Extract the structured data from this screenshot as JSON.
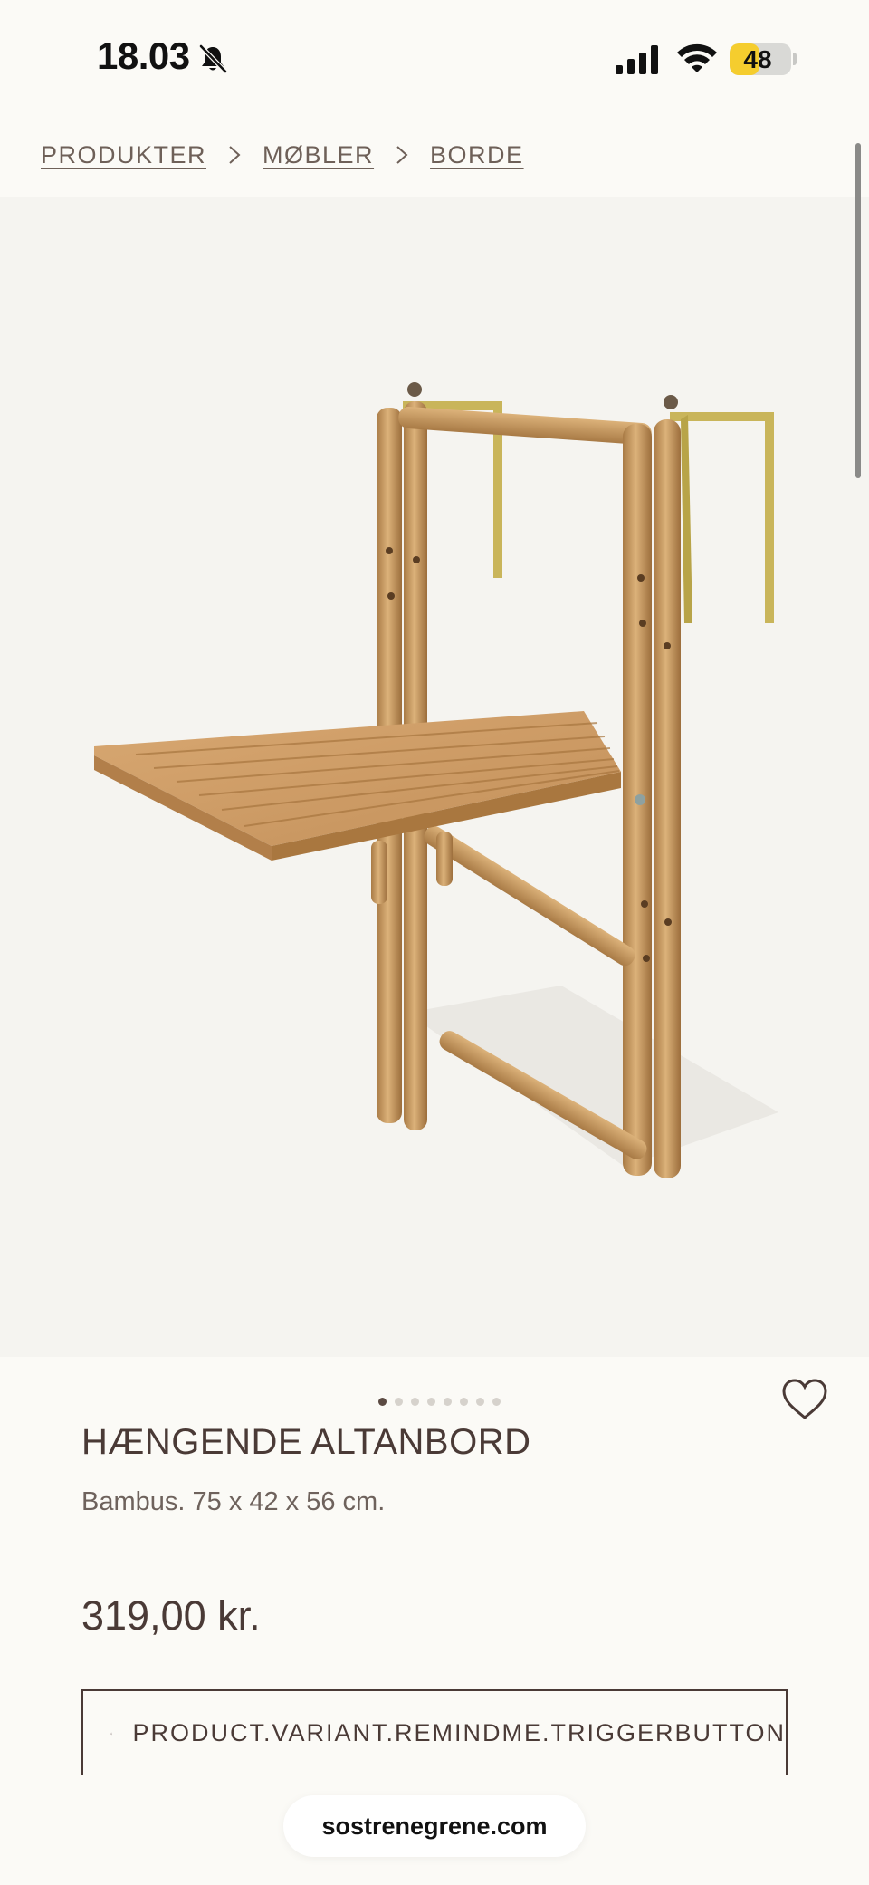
{
  "status_bar": {
    "time": "18.03",
    "battery_level": "48",
    "battery_fraction": 0.48,
    "icons": [
      "bell-off-icon",
      "signal-icon",
      "wifi-icon",
      "battery-icon"
    ]
  },
  "breadcrumb": {
    "items": [
      "PRODUKTER",
      "MØBLER",
      "BORDE"
    ],
    "separator_icon": "chevron-right-icon"
  },
  "gallery": {
    "image_count": 8,
    "active_index": 0,
    "image_subject": "hanging bamboo balcony table"
  },
  "product": {
    "title": "HÆNGENDE ALTANBORD",
    "description": "Bambus. 75 x 42 x 56 cm.",
    "price": "319,00 kr.",
    "favorite_icon": "heart-outline-icon",
    "remind_button_label": "PRODUCT.VARIANT.REMINDME.TRIGGERBUTTON",
    "remind_button_icon": "bell-icon"
  },
  "browser": {
    "url": "sostrenegrene.com"
  },
  "colors": {
    "background": "#fbfaf6",
    "image_background": "#f5f4f0",
    "text_primary": "#4a3a36",
    "battery": "#f5cd2e"
  }
}
